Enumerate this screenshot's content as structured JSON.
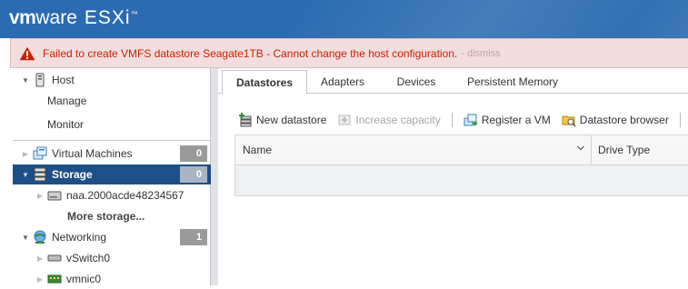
{
  "header": {
    "logo_vm": "vm",
    "logo_ware": "ware",
    "logo_product": "ESXi",
    "logo_tm": "™",
    "bg_color": "#2b6bb1"
  },
  "alert": {
    "message": "Failed to create VMFS datastore Seagate1TB - Cannot change the host configuration.",
    "dismiss": "- dismiss",
    "icon": "warning-icon",
    "color": "#c92100"
  },
  "sidebar": {
    "host": {
      "label": "Host",
      "icon": "host-icon",
      "expanded": true
    },
    "host_items": [
      {
        "label": "Manage"
      },
      {
        "label": "Monitor"
      }
    ],
    "virtual_machines": {
      "label": "Virtual Machines",
      "count": "0",
      "icon": "vm-icon"
    },
    "storage": {
      "label": "Storage",
      "count": "0",
      "icon": "storage-icon",
      "selected": true
    },
    "storage_items": [
      {
        "label": "naa.2000acde48234567",
        "icon": "disk-icon"
      },
      {
        "label": "More storage..."
      }
    ],
    "networking": {
      "label": "Networking",
      "count": "1",
      "icon": "network-icon"
    },
    "network_items": [
      {
        "label": "vSwitch0",
        "icon": "vswitch-icon"
      },
      {
        "label": "vmnic0",
        "icon": "nic-icon"
      }
    ],
    "selected_color": "#1e4f86"
  },
  "tabs": [
    {
      "label": "Datastores",
      "active": true
    },
    {
      "label": "Adapters"
    },
    {
      "label": "Devices"
    },
    {
      "label": "Persistent Memory"
    }
  ],
  "toolbar": {
    "new_datastore": "New datastore",
    "increase_capacity": "Increase capacity",
    "register_vm": "Register a VM",
    "datastore_browser": "Datastore browser"
  },
  "grid": {
    "columns": [
      "Name",
      "Drive Type"
    ],
    "rows": []
  }
}
